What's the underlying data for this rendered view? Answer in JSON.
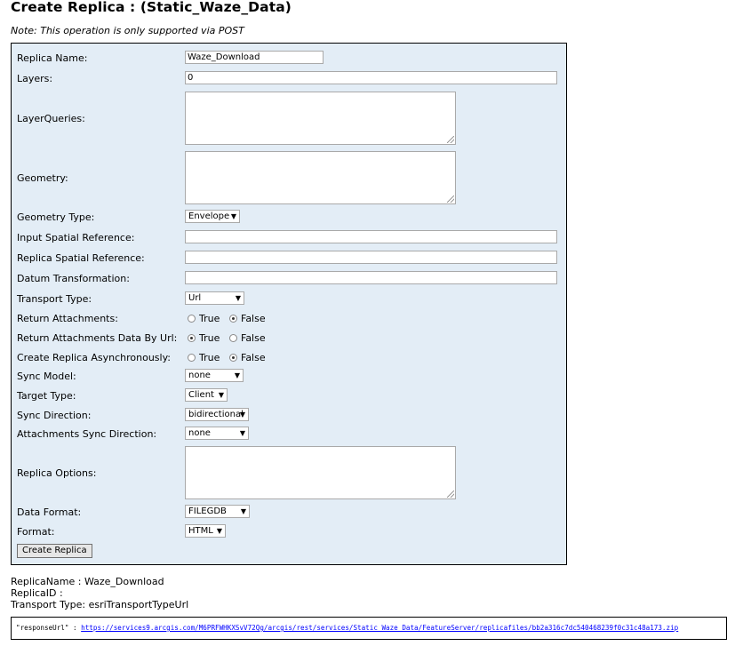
{
  "page": {
    "title": "Create Replica : (Static_Waze_Data)",
    "note": "Note: This operation is only supported via POST"
  },
  "form": {
    "replica_name": {
      "label": "Replica Name:",
      "value": "Waze_Download"
    },
    "layers": {
      "label": "Layers:",
      "value": "0"
    },
    "layer_queries": {
      "label": "LayerQueries:",
      "value": ""
    },
    "geometry": {
      "label": "Geometry:",
      "value": ""
    },
    "geometry_type": {
      "label": "Geometry Type:",
      "selected": "Envelope"
    },
    "input_sr": {
      "label": "Input Spatial Reference:",
      "value": ""
    },
    "replica_sr": {
      "label": "Replica Spatial Reference:",
      "value": ""
    },
    "datum_transformation": {
      "label": "Datum Transformation:",
      "value": ""
    },
    "transport_type": {
      "label": "Transport Type:",
      "selected": "Url"
    },
    "return_attachments": {
      "label": "Return Attachments:",
      "options": [
        "True",
        "False"
      ],
      "selected": "False"
    },
    "return_attachments_by_url": {
      "label": "Return Attachments Data By Url:",
      "options": [
        "True",
        "False"
      ],
      "selected": "True"
    },
    "async": {
      "label": "Create Replica Asynchronously:",
      "options": [
        "True",
        "False"
      ],
      "selected": "False"
    },
    "sync_model": {
      "label": "Sync Model:",
      "selected": "none"
    },
    "target_type": {
      "label": "Target Type:",
      "selected": "Client"
    },
    "sync_direction": {
      "label": "Sync Direction:",
      "selected": "bidirectional"
    },
    "attachments_sync_direction": {
      "label": "Attachments Sync Direction:",
      "selected": "none"
    },
    "replica_options": {
      "label": "Replica Options:",
      "value": ""
    },
    "data_format": {
      "label": "Data Format:",
      "selected": "FILEGDB"
    },
    "format": {
      "label": "Format:",
      "selected": "HTML"
    },
    "submit_label": "Create Replica"
  },
  "result": {
    "replica_name": "ReplicaName : Waze_Download",
    "replica_id": "ReplicaID :",
    "transport_type": "Transport Type: esriTransportTypeUrl",
    "response_key": "\"responseUrl\" : ",
    "response_url": "https://services9.arcgis.com/M6PRFWHKXSvV72Qg/arcgis/rest/services/Static_Waze_Data/FeatureServer/replicafiles/bb2a316c7dc540468239f0c31c48a173.zip"
  },
  "icons": {
    "dropdown": "dropdown-arrow-icon",
    "resize": "resize-grip-icon"
  }
}
